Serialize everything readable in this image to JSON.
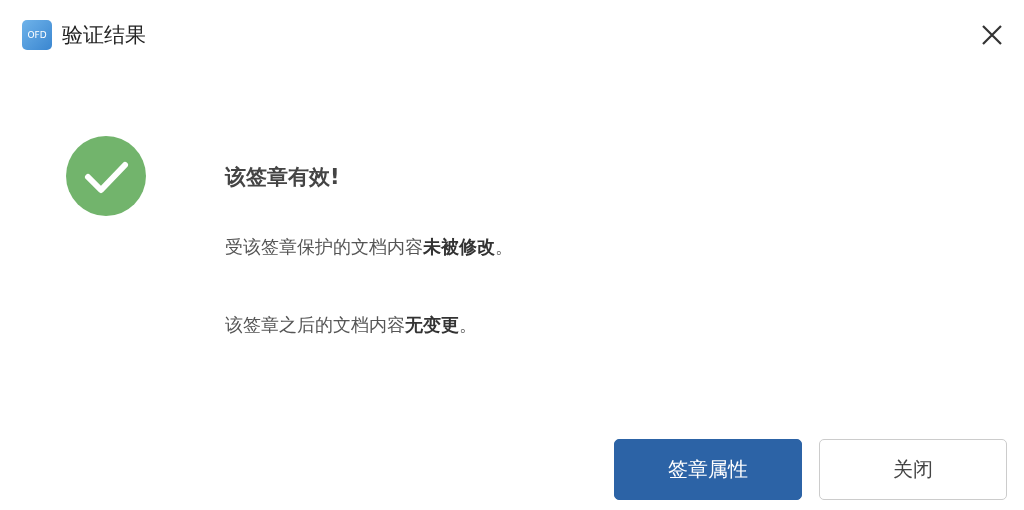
{
  "window": {
    "logo_text": "OFD",
    "title": "验证结果"
  },
  "result": {
    "heading": "该签章有效!",
    "lines": [
      "受该签章保护的文档内容**未被修改**。",
      "该签章之后的文档内容**无变更**。"
    ]
  },
  "buttons": [
    {
      "label": "签章属性",
      "kind": "primary"
    },
    {
      "label": "关闭",
      "kind": "default"
    }
  ]
}
